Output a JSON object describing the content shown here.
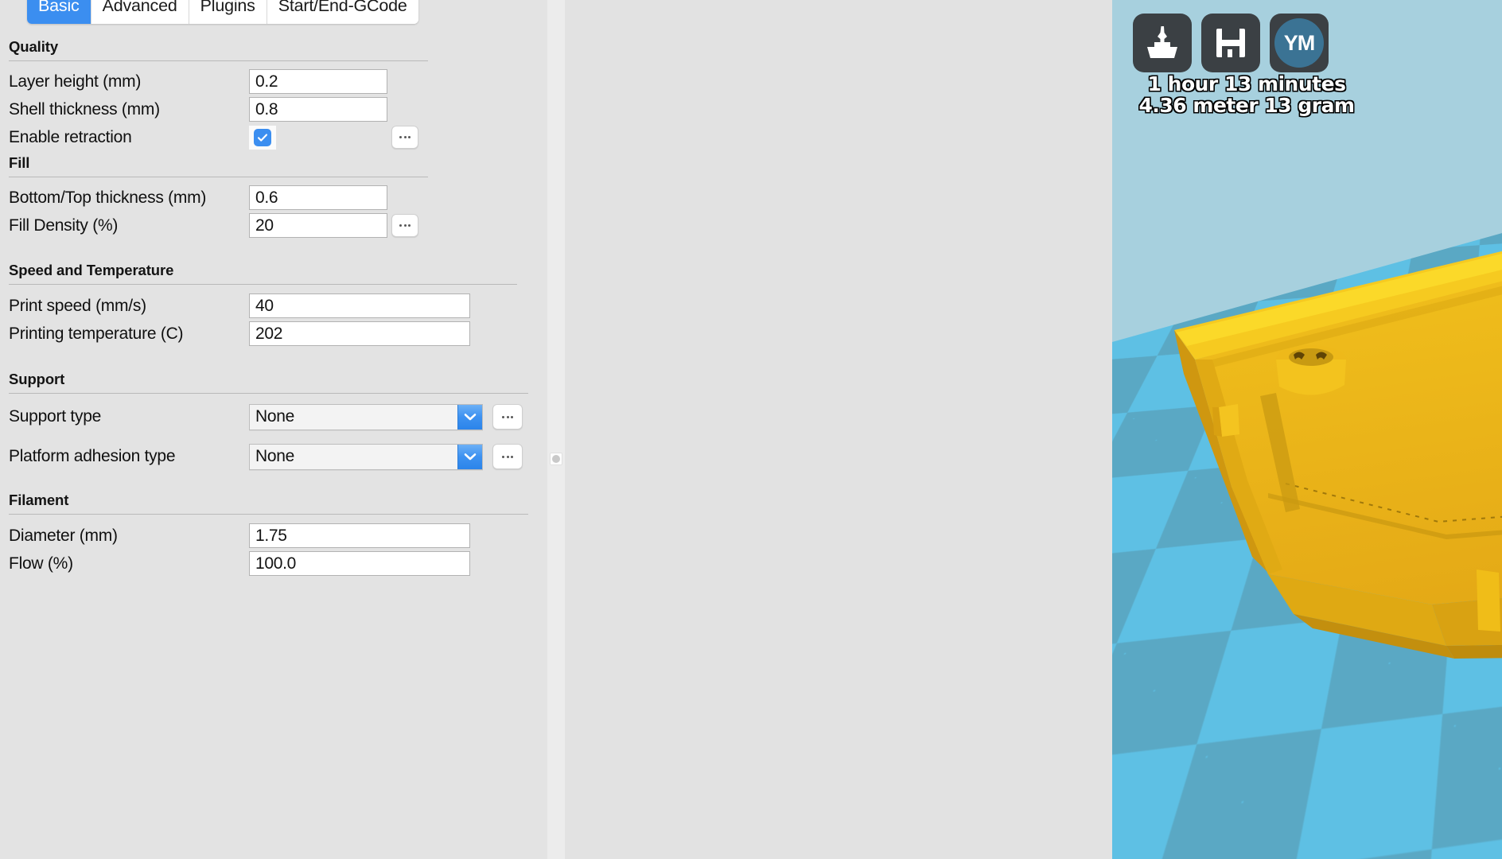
{
  "tabs": [
    {
      "label": "Basic",
      "active": true
    },
    {
      "label": "Advanced",
      "active": false
    },
    {
      "label": "Plugins",
      "active": false
    },
    {
      "label": "Start/End-GCode",
      "active": false
    }
  ],
  "groups": {
    "quality": {
      "title": "Quality",
      "layer_height_label": "Layer height (mm)",
      "layer_height_value": "0.2",
      "shell_thickness_label": "Shell thickness (mm)",
      "shell_thickness_value": "0.8",
      "enable_retraction_label": "Enable retraction",
      "enable_retraction_checked": true
    },
    "fill": {
      "title": "Fill",
      "bottom_top_label": "Bottom/Top thickness (mm)",
      "bottom_top_value": "0.6",
      "fill_density_label": "Fill Density (%)",
      "fill_density_value": "20"
    },
    "speed_temp": {
      "title": "Speed and Temperature",
      "print_speed_label": "Print speed (mm/s)",
      "print_speed_value": "40",
      "printing_temperature_label": "Printing temperature (C)",
      "printing_temperature_value": "202"
    },
    "support": {
      "title": "Support",
      "support_type_label": "Support type",
      "support_type_value": "None",
      "platform_adhesion_label": "Platform adhesion type",
      "platform_adhesion_value": "None"
    },
    "filament": {
      "title": "Filament",
      "diameter_label": "Diameter (mm)",
      "diameter_value": "1.75",
      "flow_label": "Flow (%)",
      "flow_value": "100.0"
    }
  },
  "more_button_label": "...",
  "viewport": {
    "toolbar": [
      {
        "name": "load-model-icon",
        "tooltip": "Load model"
      },
      {
        "name": "save-toolpath-icon",
        "tooltip": "Save toolpath"
      },
      {
        "name": "youmagine-icon",
        "label": "YM"
      }
    ],
    "print_time": "1 hour 13 minutes",
    "print_material": "4.36 meter 13 gram"
  },
  "colors": {
    "accent_blue": "#3b8ef0",
    "panel_bg": "#e3e3e3",
    "viewport_bg": "#a5cfde",
    "plate_light": "#5ec0e4",
    "plate_dark": "#5aa8c4",
    "model_top": "#f5c820",
    "model_mid": "#e9ae1a",
    "model_side": "#d99f14",
    "toolbar_btn": "#3b4044",
    "youmagine_circle": "#3b7394"
  }
}
